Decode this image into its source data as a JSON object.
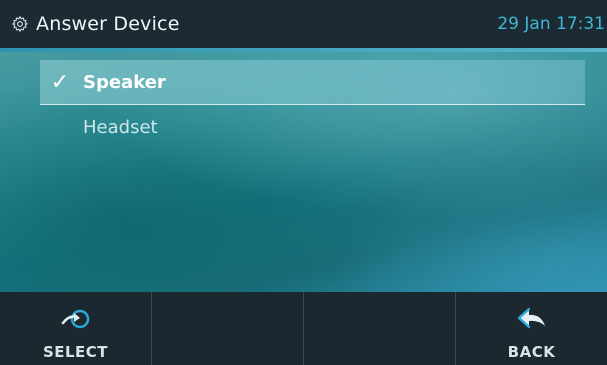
{
  "header": {
    "title": "Answer Device",
    "datetime": "29 Jan 17:31",
    "icon": "gear-icon"
  },
  "menu": {
    "items": [
      {
        "label": "Speaker",
        "selected": true,
        "check": "✓"
      },
      {
        "label": "Headset",
        "selected": false
      }
    ]
  },
  "softkeys": [
    {
      "label": "SELECT",
      "icon": "select-arrow-icon"
    },
    {
      "label": ""
    },
    {
      "label": ""
    },
    {
      "label": "BACK",
      "icon": "back-arrow-icon"
    }
  ],
  "colors": {
    "header_bg": "#1c2a33",
    "datetime": "#3fb6d2",
    "softkey_bg": "#1b2830",
    "accent_blue": "#29a9d8"
  }
}
